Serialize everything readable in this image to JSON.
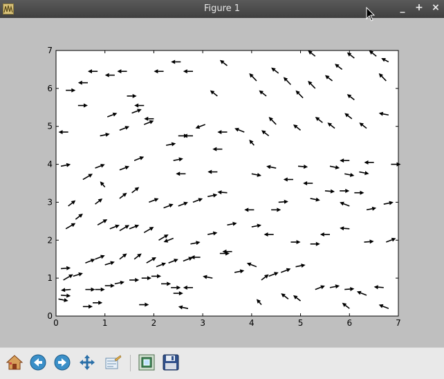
{
  "window": {
    "title": "Figure 1",
    "buttons": [
      "_",
      "+",
      "×"
    ]
  },
  "toolbar": {
    "home_icon": "home-icon",
    "back_icon": "back-arrow-icon",
    "forward_icon": "forward-arrow-icon",
    "pan_icon": "pan-move-icon",
    "configure_icon": "configure-subplots-icon",
    "zoom_icon": "zoom-rect-icon",
    "save_icon": "floppy-save-icon"
  },
  "chart_data": {
    "type": "quiver",
    "xlim": [
      0,
      7
    ],
    "ylim": [
      0,
      7
    ],
    "xticks": [
      "0",
      "1",
      "2",
      "3",
      "4",
      "5",
      "6",
      "7"
    ],
    "yticks": [
      "0",
      "1",
      "2",
      "3",
      "4",
      "5",
      "6",
      "7"
    ],
    "grid": false,
    "arrow_color": "#000000",
    "arrows": [
      [
        0.05,
        0.45,
        0.2,
        -0.05
      ],
      [
        0.1,
        0.55,
        0.2,
        -0.02
      ],
      [
        0.55,
        0.25,
        0.2,
        0
      ],
      [
        0.75,
        0.35,
        0.2,
        0
      ],
      [
        0.3,
        0.7,
        -0.2,
        -0.02
      ],
      [
        0.15,
        0.95,
        0.2,
        0.15
      ],
      [
        0.35,
        1.05,
        0.2,
        0.08
      ],
      [
        0.6,
        0.7,
        0.2,
        0
      ],
      [
        0.8,
        0.7,
        0.2,
        0
      ],
      [
        1.0,
        0.8,
        0.2,
        0
      ],
      [
        1.2,
        0.85,
        0.2,
        0.05
      ],
      [
        1.5,
        0.95,
        0.2,
        0
      ],
      [
        1.75,
        1.0,
        0.2,
        0
      ],
      [
        1.95,
        1.05,
        0.2,
        0
      ],
      [
        2.15,
        0.85,
        0.2,
        0
      ],
      [
        2.35,
        0.75,
        0.2,
        0
      ],
      [
        1.7,
        0.3,
        0.2,
        0
      ],
      [
        2.4,
        0.6,
        0.2,
        0
      ],
      [
        2.7,
        0.2,
        -0.2,
        0.05
      ],
      [
        2.8,
        0.75,
        -0.2,
        0
      ],
      [
        0.1,
        1.25,
        0.2,
        0.02
      ],
      [
        0.6,
        1.4,
        0.2,
        0.1
      ],
      [
        0.8,
        1.5,
        0.2,
        0.1
      ],
      [
        1.0,
        1.35,
        0.2,
        0.08
      ],
      [
        1.3,
        1.5,
        0.15,
        0.15
      ],
      [
        1.6,
        1.5,
        0.15,
        0.15
      ],
      [
        1.85,
        1.4,
        0.2,
        0.15
      ],
      [
        2.05,
        1.3,
        0.2,
        0.1
      ],
      [
        2.3,
        1.4,
        0.2,
        0.1
      ],
      [
        2.6,
        1.45,
        0.2,
        0.1
      ],
      [
        2.95,
        1.55,
        -0.2,
        0
      ],
      [
        3.35,
        1.65,
        0.2,
        0
      ],
      [
        3.6,
        1.7,
        -0.2,
        0
      ],
      [
        3.2,
        1.0,
        -0.2,
        0.05
      ],
      [
        3.65,
        1.15,
        0.2,
        0.05
      ],
      [
        4.1,
        1.3,
        -0.2,
        0.1
      ],
      [
        4.2,
        0.95,
        0.15,
        0.15
      ],
      [
        4.35,
        1.05,
        0.2,
        0.1
      ],
      [
        4.6,
        1.15,
        0.2,
        0.1
      ],
      [
        4.9,
        1.3,
        0.2,
        0.05
      ],
      [
        4.2,
        0.3,
        -0.1,
        0.15
      ],
      [
        4.75,
        0.45,
        -0.15,
        0.15
      ],
      [
        5.0,
        0.4,
        -0.15,
        0.15
      ],
      [
        5.3,
        0.7,
        0.2,
        0.1
      ],
      [
        5.6,
        0.75,
        0.2,
        0.05
      ],
      [
        5.9,
        0.7,
        0.2,
        0.02
      ],
      [
        6.0,
        0.2,
        -0.15,
        0.15
      ],
      [
        6.35,
        0.55,
        -0.2,
        0.1
      ],
      [
        6.7,
        0.75,
        -0.2,
        0.02
      ],
      [
        6.8,
        0.2,
        -0.2,
        0.1
      ],
      [
        0.2,
        2.3,
        0.2,
        0.15
      ],
      [
        0.4,
        2.55,
        0.15,
        0.15
      ],
      [
        0.85,
        2.4,
        0.2,
        0.15
      ],
      [
        1.1,
        2.3,
        0.2,
        0.1
      ],
      [
        1.3,
        2.25,
        0.2,
        0.15
      ],
      [
        1.5,
        2.3,
        0.2,
        0.1
      ],
      [
        1.8,
        2.2,
        0.2,
        0.15
      ],
      [
        2.1,
        2.0,
        0.2,
        0.15
      ],
      [
        2.4,
        2.05,
        -0.2,
        -0.1
      ],
      [
        2.75,
        1.9,
        0.2,
        0.05
      ],
      [
        3.1,
        2.15,
        0.2,
        0.05
      ],
      [
        3.5,
        2.4,
        0.2,
        0.05
      ],
      [
        4.0,
        2.35,
        0.2,
        0.05
      ],
      [
        4.45,
        2.15,
        -0.2,
        0
      ],
      [
        4.8,
        1.95,
        0.2,
        0
      ],
      [
        5.2,
        1.9,
        0.2,
        0
      ],
      [
        5.6,
        2.15,
        -0.2,
        0
      ],
      [
        6.0,
        2.3,
        -0.2,
        0.02
      ],
      [
        6.3,
        1.95,
        0.2,
        0.02
      ],
      [
        6.75,
        1.95,
        0.2,
        0.1
      ],
      [
        0.25,
        2.9,
        0.15,
        0.15
      ],
      [
        0.8,
        2.95,
        0.15,
        0.15
      ],
      [
        1.3,
        3.1,
        0.15,
        0.15
      ],
      [
        1.55,
        3.25,
        0.15,
        0.15
      ],
      [
        1.9,
        3.0,
        0.2,
        0.1
      ],
      [
        2.2,
        2.85,
        0.2,
        0.1
      ],
      [
        2.5,
        2.9,
        0.2,
        0.1
      ],
      [
        2.8,
        3.0,
        0.2,
        0.1
      ],
      [
        3.1,
        3.15,
        0.2,
        0.05
      ],
      [
        3.5,
        3.25,
        -0.2,
        0.02
      ],
      [
        4.05,
        2.8,
        -0.2,
        0
      ],
      [
        4.4,
        2.8,
        0.2,
        0
      ],
      [
        4.55,
        3.0,
        0.2,
        0.02
      ],
      [
        5.2,
        3.1,
        0.2,
        -0.05
      ],
      [
        5.5,
        3.3,
        0.2,
        -0.02
      ],
      [
        5.8,
        3.3,
        0.2,
        0
      ],
      [
        6.1,
        3.25,
        0.2,
        0
      ],
      [
        6.35,
        2.8,
        0.2,
        0.05
      ],
      [
        6.7,
        2.95,
        0.2,
        0.05
      ],
      [
        6.0,
        2.9,
        -0.2,
        0.1
      ],
      [
        0.1,
        3.95,
        0.2,
        0.05
      ],
      [
        0.55,
        3.6,
        0.2,
        0.15
      ],
      [
        0.8,
        3.9,
        0.2,
        0.1
      ],
      [
        1.0,
        3.4,
        -0.1,
        0.15
      ],
      [
        1.3,
        3.85,
        0.2,
        0.1
      ],
      [
        1.6,
        4.1,
        0.2,
        0.1
      ],
      [
        2.4,
        4.1,
        0.2,
        0.05
      ],
      [
        2.65,
        3.75,
        -0.2,
        0
      ],
      [
        3.3,
        3.8,
        -0.2,
        0
      ],
      [
        4.0,
        3.75,
        0.2,
        -0.05
      ],
      [
        4.5,
        3.9,
        -0.2,
        0.05
      ],
      [
        4.95,
        3.95,
        0.2,
        -0.02
      ],
      [
        5.6,
        3.95,
        0.2,
        -0.05
      ],
      [
        5.9,
        3.75,
        0.2,
        -0.05
      ],
      [
        6.2,
        3.8,
        0.2,
        -0.05
      ],
      [
        6.5,
        4.05,
        -0.2,
        0
      ],
      [
        6.85,
        4.0,
        0.2,
        0
      ],
      [
        6.0,
        4.1,
        -0.2,
        0
      ],
      [
        4.85,
        3.6,
        -0.2,
        0
      ],
      [
        5.25,
        3.5,
        -0.2,
        0
      ],
      [
        0.25,
        4.85,
        -0.2,
        0
      ],
      [
        0.45,
        5.55,
        0.2,
        0
      ],
      [
        0.9,
        4.75,
        0.2,
        0.05
      ],
      [
        1.05,
        5.25,
        0.2,
        0.1
      ],
      [
        1.3,
        4.9,
        0.2,
        0.1
      ],
      [
        1.55,
        5.35,
        0.2,
        0.1
      ],
      [
        1.8,
        5.05,
        0.2,
        0.1
      ],
      [
        2.0,
        5.2,
        -0.2,
        0
      ],
      [
        2.25,
        4.5,
        0.2,
        0.05
      ],
      [
        2.5,
        4.75,
        0.2,
        0
      ],
      [
        2.8,
        4.75,
        -0.2,
        0
      ],
      [
        3.05,
        5.05,
        -0.2,
        -0.1
      ],
      [
        3.4,
        4.4,
        -0.2,
        0
      ],
      [
        3.5,
        4.85,
        -0.2,
        0
      ],
      [
        3.85,
        4.85,
        -0.2,
        0.1
      ],
      [
        4.05,
        4.5,
        -0.1,
        0.15
      ],
      [
        4.35,
        4.75,
        -0.15,
        0.15
      ],
      [
        4.5,
        5.05,
        -0.15,
        0.2
      ],
      [
        5.0,
        4.9,
        -0.15,
        0.15
      ],
      [
        5.45,
        5.1,
        -0.15,
        0.15
      ],
      [
        5.7,
        4.95,
        -0.15,
        0.15
      ],
      [
        6.05,
        5.2,
        -0.15,
        0.15
      ],
      [
        6.35,
        4.95,
        -0.15,
        0.15
      ],
      [
        6.8,
        5.3,
        -0.2,
        0.05
      ],
      [
        6.1,
        5.7,
        -0.15,
        0.15
      ],
      [
        0.2,
        5.95,
        0.2,
        0
      ],
      [
        0.65,
        6.15,
        -0.2,
        0
      ],
      [
        0.85,
        6.45,
        -0.2,
        0
      ],
      [
        1.2,
        6.35,
        -0.2,
        0
      ],
      [
        1.45,
        6.45,
        -0.2,
        0
      ],
      [
        1.45,
        5.8,
        0.2,
        0
      ],
      [
        1.8,
        5.55,
        -0.2,
        0
      ],
      [
        2.2,
        6.45,
        -0.2,
        0
      ],
      [
        2.55,
        6.7,
        -0.2,
        0
      ],
      [
        2.8,
        6.45,
        -0.2,
        0
      ],
      [
        3.3,
        5.8,
        -0.15,
        0.15
      ],
      [
        3.5,
        6.6,
        -0.15,
        0.15
      ],
      [
        4.1,
        6.2,
        -0.15,
        0.2
      ],
      [
        4.55,
        6.4,
        -0.15,
        0.15
      ],
      [
        4.8,
        6.1,
        -0.15,
        0.2
      ],
      [
        5.05,
        5.75,
        -0.15,
        0.2
      ],
      [
        5.3,
        6.0,
        -0.15,
        0.2
      ],
      [
        5.65,
        6.2,
        -0.15,
        0.15
      ],
      [
        5.85,
        6.5,
        -0.15,
        0.15
      ],
      [
        6.1,
        6.8,
        -0.15,
        0.15
      ],
      [
        6.55,
        6.85,
        -0.15,
        0.15
      ],
      [
        6.8,
        6.7,
        -0.15,
        0.1
      ],
      [
        6.75,
        6.2,
        -0.15,
        0.2
      ],
      [
        4.3,
        5.8,
        -0.15,
        0.15
      ],
      [
        5.3,
        6.85,
        -0.15,
        0.15
      ]
    ]
  }
}
